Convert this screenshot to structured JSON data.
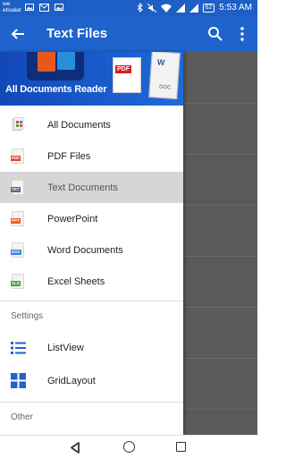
{
  "status_bar": {
    "carrier_line1": "we",
    "carrier_line2": "etisalat",
    "battery": "62",
    "time": "5:53 AM"
  },
  "app_bar": {
    "title": "Text Files",
    "back_icon": "arrow-back-icon",
    "search_icon": "search-icon",
    "more_icon": "more-vert-icon"
  },
  "drawer": {
    "banner_title": "All Documents Reader",
    "banner_pdf_tag": "PDF",
    "banner_doc_letter": "W",
    "banner_doc_tag": "DOC",
    "items": [
      {
        "label": "All Documents",
        "icon": "all-documents-icon"
      },
      {
        "label": "PDF Files",
        "icon": "pdf-file-icon",
        "tag": "PDF",
        "color": "#e04a3a"
      },
      {
        "label": "Text Documents",
        "icon": "txt-file-icon",
        "tag": "TXT",
        "color": "#5b6b8c"
      },
      {
        "label": "PowerPoint",
        "icon": "ppt-file-icon",
        "tag": "PPT",
        "color": "#e8572a"
      },
      {
        "label": "Word Documents",
        "icon": "doc-file-icon",
        "tag": "DOC",
        "color": "#3f82d6"
      },
      {
        "label": "Excel Sheets",
        "icon": "xls-file-icon",
        "tag": "XLS",
        "color": "#3ea34d"
      }
    ],
    "settings_label": "Settings",
    "settings_items": [
      {
        "label": "ListView",
        "icon": "list-view-icon"
      },
      {
        "label": "GridLayout",
        "icon": "grid-layout-icon"
      }
    ],
    "other_label": "Other"
  },
  "colors": {
    "primary": "#1e64cc",
    "status_bar": "#1d5fc4",
    "selected_row": "#d6d6d6",
    "icon_blue": "#1e64cc"
  }
}
